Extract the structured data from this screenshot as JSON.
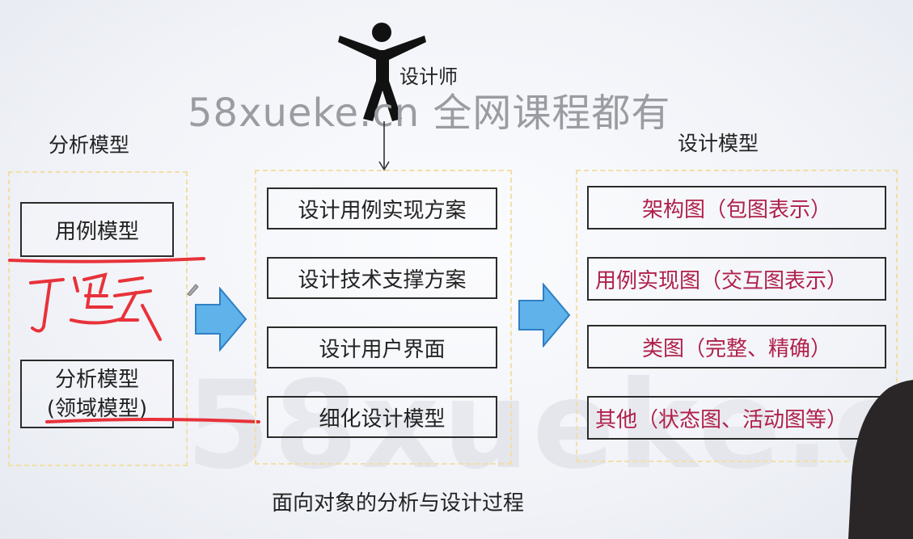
{
  "watermark": {
    "top_text": "58xueke.cn  全网课程都有",
    "big_text": "58xueke.c"
  },
  "designer_label": "设计师",
  "analysis_model": {
    "heading": "分析模型",
    "box1": "用例模型",
    "box2_line1": "分析模型",
    "box2_line2": "(领域模型)"
  },
  "middle": {
    "items": [
      "设计用例实现方案",
      "设计技术支撑方案",
      "设计用户界面",
      "细化设计模型"
    ]
  },
  "design_model": {
    "heading": "设计模型",
    "items": [
      "架构图（包图表示）",
      "用例实现图（交互图表示）",
      "类图（完整、精确）",
      "其他（状态图、活动图等）"
    ]
  },
  "caption": "面向对象的分析与设计过程",
  "colors": {
    "arrow_fill": "#5fb3ea",
    "arrow_stroke": "#2f7fc4",
    "annotation": "#e8323a",
    "dashed": "#f1dfa6",
    "item_text_red": "#b0204a"
  }
}
